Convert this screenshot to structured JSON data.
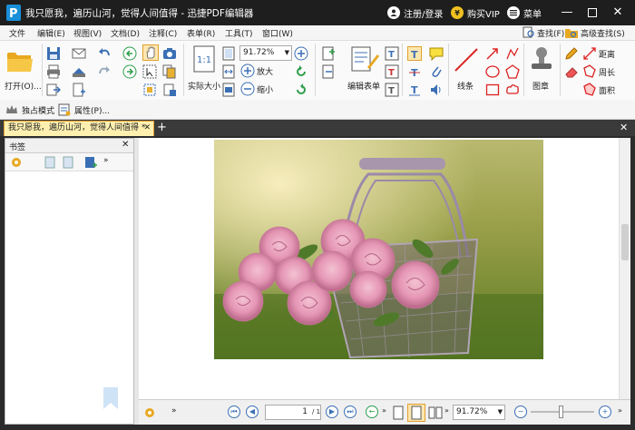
{
  "app": {
    "title": "我只愿我，遍历山河，觉得人间值得 - 迅捷PDF编辑器",
    "login": "注册/登录",
    "vip": "购买VIP",
    "menu": "菜单"
  },
  "menus": [
    "文件",
    "编辑(E)",
    "视图(V)",
    "文档(D)",
    "注释(C)",
    "表单(R)",
    "工具(T)",
    "窗口(W)"
  ],
  "ribbon": {
    "open_label": "打开(O)...",
    "actual_size_label": "实际大小",
    "zoom_value": "91.72%",
    "zoom_in_label": "放大",
    "zoom_out_label": "缩小",
    "edit_form_label": "编辑表单",
    "line_label": "线条",
    "stamp_label": "图章",
    "distance_label": "距离",
    "perimeter_label": "周长",
    "area_label": "面积",
    "find_label": "查找(F)",
    "advanced_find_label": "高级查找(S)"
  },
  "toolrow": {
    "exclusive_mode": "独占模式",
    "properties": "属性(P)..."
  },
  "tab": {
    "doc_title": "我只愿我，遍历山河，觉得人间值得 *"
  },
  "sidebar": {
    "title": "书签"
  },
  "status": {
    "page_value": "1",
    "page_total": "/ 1",
    "zoom_value": "91.72%"
  },
  "colors": {
    "accent": "#3b6fb5",
    "titlebar": "#1e1e1e",
    "vip_yellow": "#f0c020",
    "tab_yellow": "#fff0b0"
  }
}
